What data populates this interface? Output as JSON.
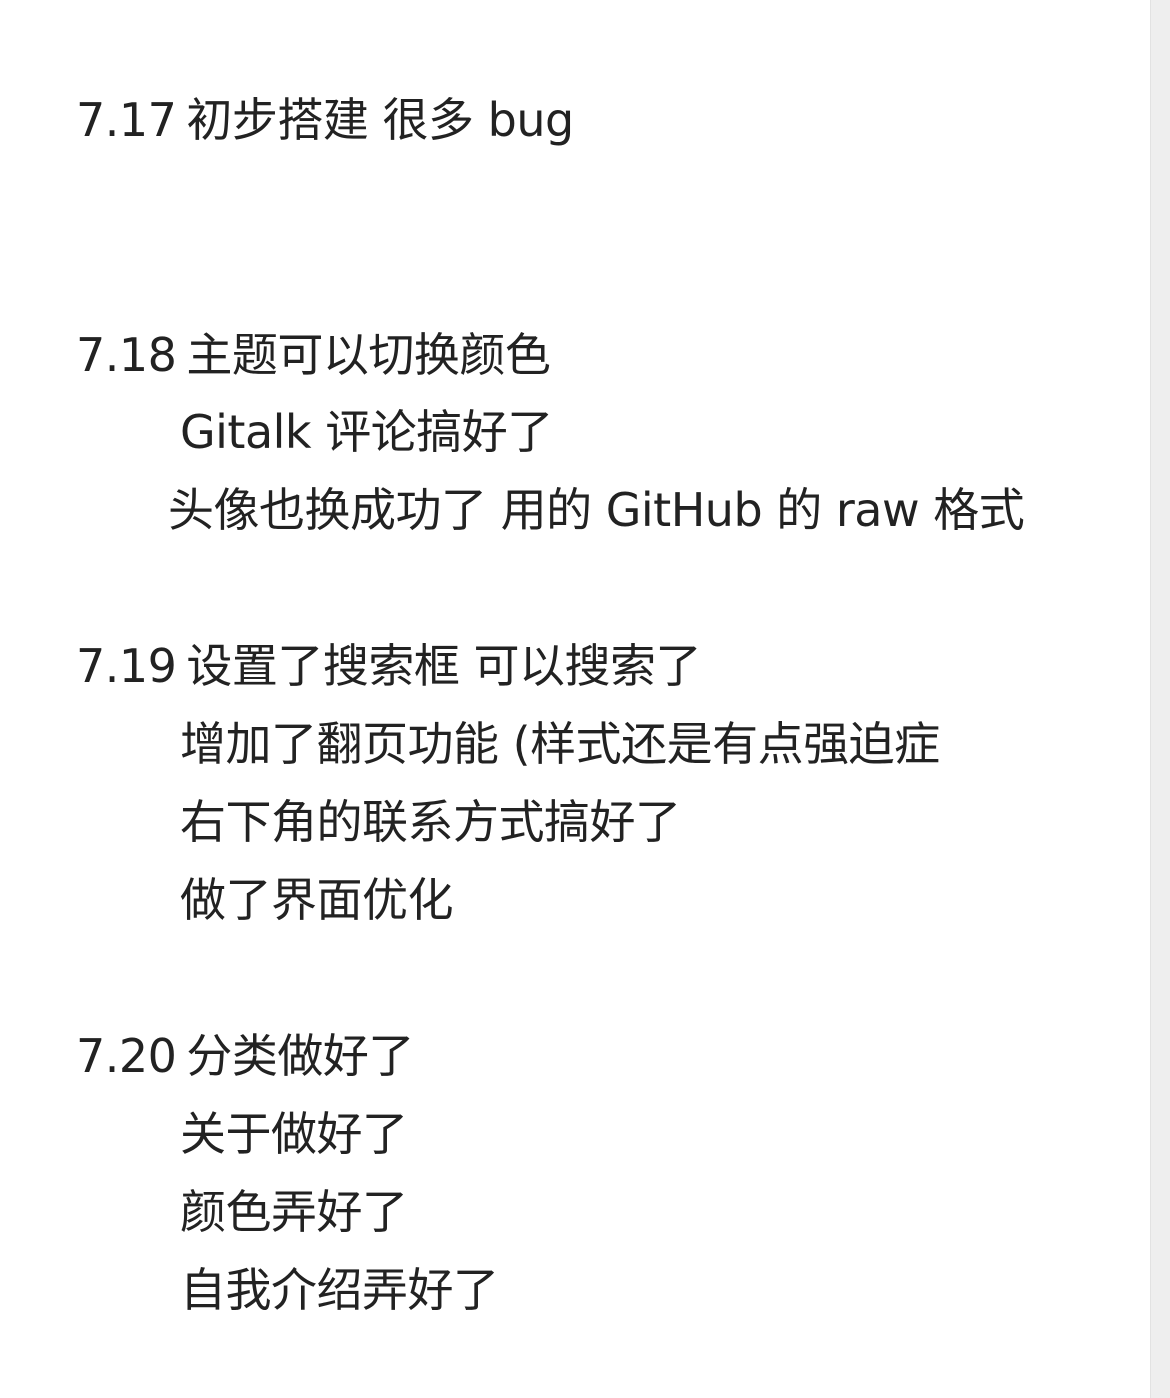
{
  "note": {
    "entries": [
      {
        "date": "7.17",
        "lines": [
          "初步搭建 很多 bug"
        ]
      },
      {
        "date": "7.18",
        "lines": [
          "主题可以切换颜色",
          "Gitalk 评论搞好了",
          "头像也换成功了 用的 GitHub 的 raw 格式"
        ]
      },
      {
        "date": "7.19",
        "lines": [
          "设置了搜索框 可以搜索了",
          "增加了翻页功能 (样式还是有点强迫症",
          "右下角的联系方式搞好了",
          "做了界面优化"
        ]
      },
      {
        "date": "7.20",
        "lines": [
          "分类做好了",
          "关于做好了",
          "颜色弄好了",
          "自我介绍弄好了"
        ]
      }
    ]
  },
  "colors": {
    "text": "#222222",
    "background": "#ffffff",
    "edge": "#eeeeee"
  }
}
